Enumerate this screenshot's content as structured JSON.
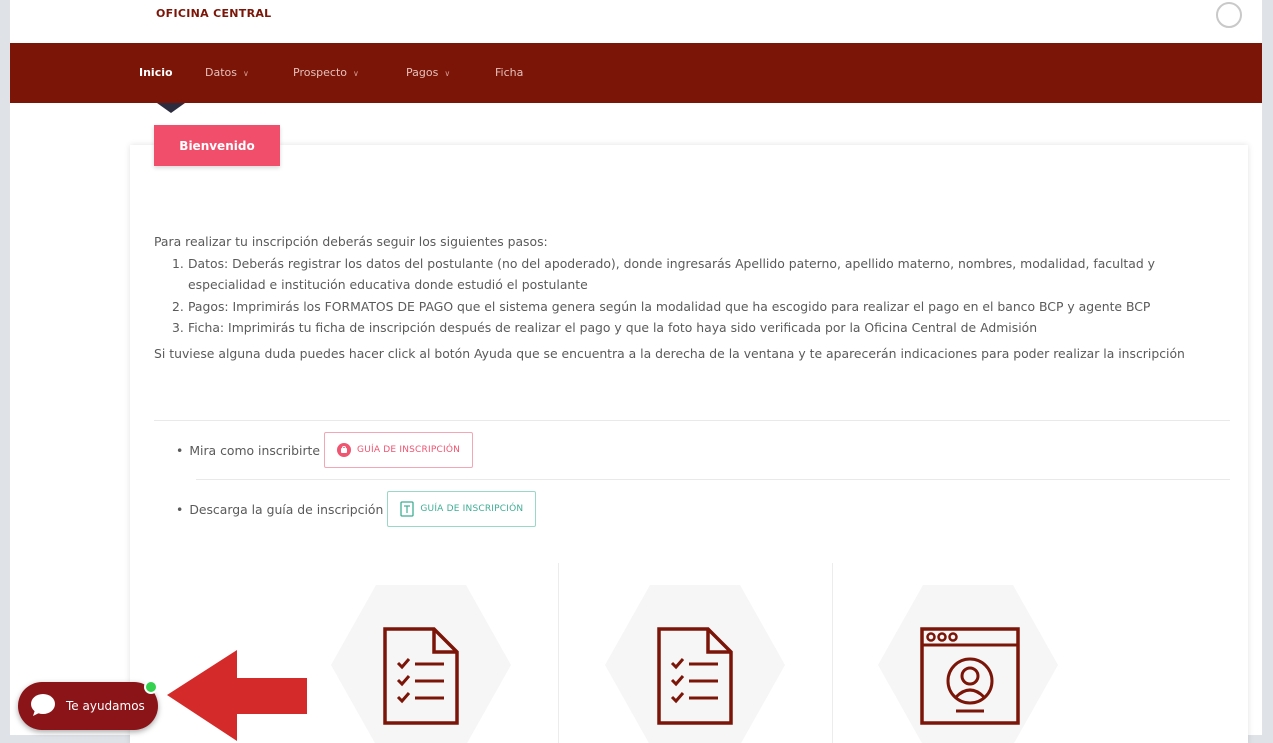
{
  "header": {
    "org_name": "OFICINA CENTRAL"
  },
  "nav": {
    "items": [
      {
        "label": "Inicio",
        "active": true,
        "has_dropdown": false
      },
      {
        "label": "Datos",
        "active": false,
        "has_dropdown": true
      },
      {
        "label": "Prospecto",
        "active": false,
        "has_dropdown": true
      },
      {
        "label": "Pagos",
        "active": false,
        "has_dropdown": true
      },
      {
        "label": "Ficha",
        "active": false,
        "has_dropdown": false
      }
    ]
  },
  "welcome": {
    "badge": "Bienvenido"
  },
  "instructions": {
    "intro": "Para realizar tu inscripción deberás seguir los siguientes pasos:",
    "steps": [
      {
        "num": "1.",
        "text": "Datos: Deberás registrar los datos del postulante (no del apoderado), donde ingresarás Apellido paterno, apellido materno, nombres, modalidad, facultad y especialidad e institución educativa donde estudió el postulante"
      },
      {
        "num": "2.",
        "text": "Pagos: Imprimirás los FORMATOS DE PAGO que el sistema genera según la modalidad que ha escogido para realizar el pago en el banco BCP y agente BCP"
      },
      {
        "num": "3.",
        "text": "Ficha: Imprimirás tu ficha de inscripción después de realizar el pago y que la foto haya sido verificada por la Oficina Central de Admisión"
      }
    ],
    "note": "Si tuviese alguna duda puedes hacer click al botón Ayuda que se encuentra a la derecha de la ventana y te aparecerán indicaciones para poder realizar la inscripción"
  },
  "links": {
    "video": {
      "text": "Mira como inscribirte",
      "button": "GUÍA DE INSCRIPCIÓN",
      "icon": "play-circle-icon"
    },
    "download": {
      "text": "Descarga la guía de inscripción",
      "button": "GUÍA DE INSCRIPCIÓN",
      "icon": "document-icon"
    }
  },
  "features": [
    {
      "icon": "checklist-icon"
    },
    {
      "icon": "checklist-icon"
    },
    {
      "icon": "browser-user-icon"
    }
  ],
  "chat": {
    "label": "Te ayudamos",
    "status": "online"
  },
  "colors": {
    "nav_bg": "#7a1508",
    "badge_bg": "#f04e6b",
    "pink_button": "#ef5470",
    "green_button": "#3fae94",
    "chat_bg": "#8b1418",
    "arrow": "#d42a2a",
    "online_dot": "#33d14d"
  }
}
